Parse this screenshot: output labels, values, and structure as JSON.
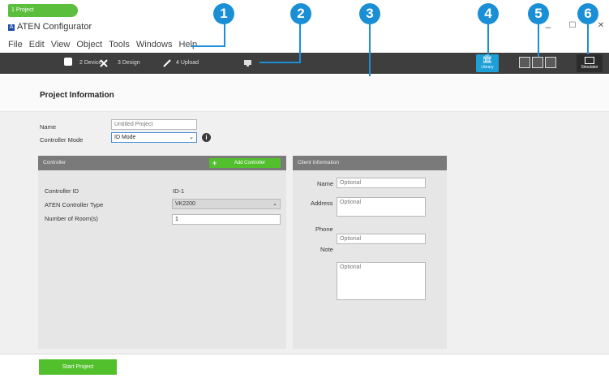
{
  "app": {
    "logo": "A",
    "title": "ATEN Configurator"
  },
  "window": {
    "minimize": "–",
    "maximize": "☐",
    "close": "✕"
  },
  "menu": [
    "File",
    "Edit",
    "View",
    "Object",
    "Tools",
    "Windows",
    "Help"
  ],
  "steps": [
    {
      "label": "1 Project",
      "active": true
    },
    {
      "label": "2 Device"
    },
    {
      "label": "3 Design"
    },
    {
      "label": "4 Upload"
    }
  ],
  "toolbar": {
    "library_label": "Library",
    "simulator_label": "Simulator"
  },
  "callouts": [
    "1",
    "2",
    "3",
    "4",
    "5",
    "6"
  ],
  "page": {
    "title": "Project Information"
  },
  "form": {
    "name_label": "Name",
    "name_placeholder": "Untitled Project",
    "mode_label": "Controller Mode",
    "mode_value": "ID Mode",
    "info": "i"
  },
  "controller": {
    "header": "Controller",
    "add_button": "Add Controller",
    "id_label": "Controller ID",
    "id_value": "ID-1",
    "type_label": "ATEN Controller Type",
    "type_value": "VK2200",
    "rooms_label": "Number of Room(s)",
    "rooms_value": "1"
  },
  "client": {
    "header": "Client Information",
    "name_label": "Name",
    "address_label": "Address",
    "phone_label": "Phone",
    "note_label": "Note",
    "placeholder": "Optional"
  },
  "footer": {
    "start_button": "Start Project"
  },
  "colors": {
    "accent_green": "#52c02c",
    "callout_blue": "#1a8fd6",
    "toolbar_dark": "#3e3e3e",
    "library_blue": "#1d9fd8"
  }
}
